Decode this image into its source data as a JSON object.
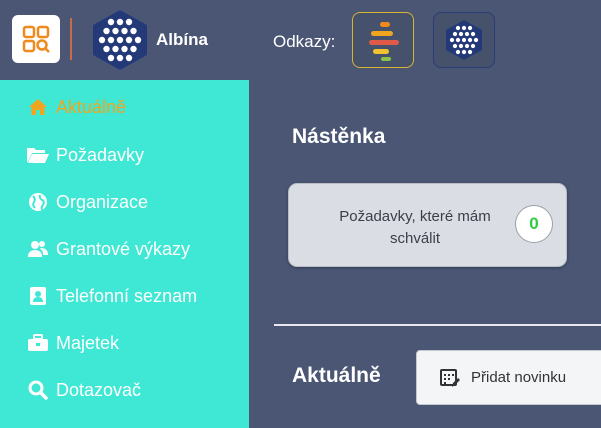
{
  "topbar": {
    "app_name": "Albína",
    "links_label": "Odkazy:",
    "apps_icon": "apps-grid-icon",
    "logo_icon": "albina-hexagon-logo",
    "links": [
      {
        "icon": "colored-bars-link-icon"
      },
      {
        "icon": "dotted-hexagon-link-icon"
      }
    ],
    "colors": {
      "accent_orange": "#f0a51e",
      "apps_icon": "#f08a1c",
      "divider": "#c96a4b",
      "logo_blue": "#243a78"
    }
  },
  "sidebar": {
    "background": "#3fe8d4",
    "items": [
      {
        "label": "Aktuálně",
        "icon": "home-icon",
        "active": true
      },
      {
        "label": "Požadavky",
        "icon": "folder-open-icon"
      },
      {
        "label": "Organizace",
        "icon": "globe-icon"
      },
      {
        "label": "Grantové výkazy",
        "icon": "users-icon"
      },
      {
        "label": "Telefonní seznam",
        "icon": "address-book-icon"
      },
      {
        "label": "Majetek",
        "icon": "briefcase-icon"
      },
      {
        "label": "Dotazovač",
        "icon": "search-icon"
      }
    ]
  },
  "main": {
    "dashboard_title": "Nástěnka",
    "card": {
      "text": "Požadavky, které mám schválit",
      "count": "0"
    },
    "news_title": "Aktuálně",
    "add_news_label": "Přidat novinku"
  }
}
